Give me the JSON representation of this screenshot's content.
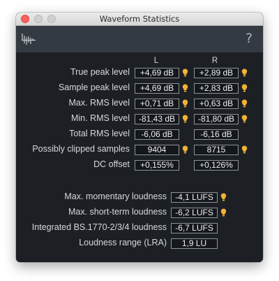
{
  "window": {
    "title": "Waveform Statistics"
  },
  "toolbar": {
    "icon": "waveform-icon",
    "help_label": "?"
  },
  "columns": {
    "left": "L",
    "right": "R"
  },
  "colors": {
    "background": "#1c2025",
    "toolbar": "#343a42",
    "value_box_border": "#8d9399",
    "indicator": "#f2b233",
    "text": "#d6d8db"
  },
  "channel_rows": [
    {
      "label": "True peak level",
      "left": "+4,69 dB",
      "right": "+2,89 dB",
      "left_indicator": true,
      "right_indicator": true
    },
    {
      "label": "Sample peak level",
      "left": "+4,69 dB",
      "right": "+2,83 dB",
      "left_indicator": true,
      "right_indicator": true
    },
    {
      "label": "Max. RMS level",
      "left": "+0,71 dB",
      "right": "+0,63 dB",
      "left_indicator": true,
      "right_indicator": true
    },
    {
      "label": "Min. RMS level",
      "left": "-81,43 dB",
      "right": "-81,80 dB",
      "left_indicator": true,
      "right_indicator": true
    },
    {
      "label": "Total RMS level",
      "left": "-6,06 dB",
      "right": "-6,16 dB",
      "left_indicator": false,
      "right_indicator": false
    },
    {
      "label": "Possibly clipped samples",
      "left": "9404",
      "right": "8715",
      "left_indicator": true,
      "right_indicator": true
    },
    {
      "label": "DC offset",
      "left": "+0,155%",
      "right": "+0,126%",
      "left_indicator": false,
      "right_indicator": false
    }
  ],
  "loudness_rows": [
    {
      "label": "Max. momentary loudness",
      "value": "-4,1 LUFS",
      "indicator": true
    },
    {
      "label": "Max. short-term loudness",
      "value": "-6,2 LUFS",
      "indicator": true
    },
    {
      "label": "Integrated BS.1770-2/3/4 loudness",
      "value": "-6,7 LUFS",
      "indicator": false
    },
    {
      "label": "Loudness range (LRA)",
      "value": "1,9 LU",
      "indicator": false
    }
  ]
}
